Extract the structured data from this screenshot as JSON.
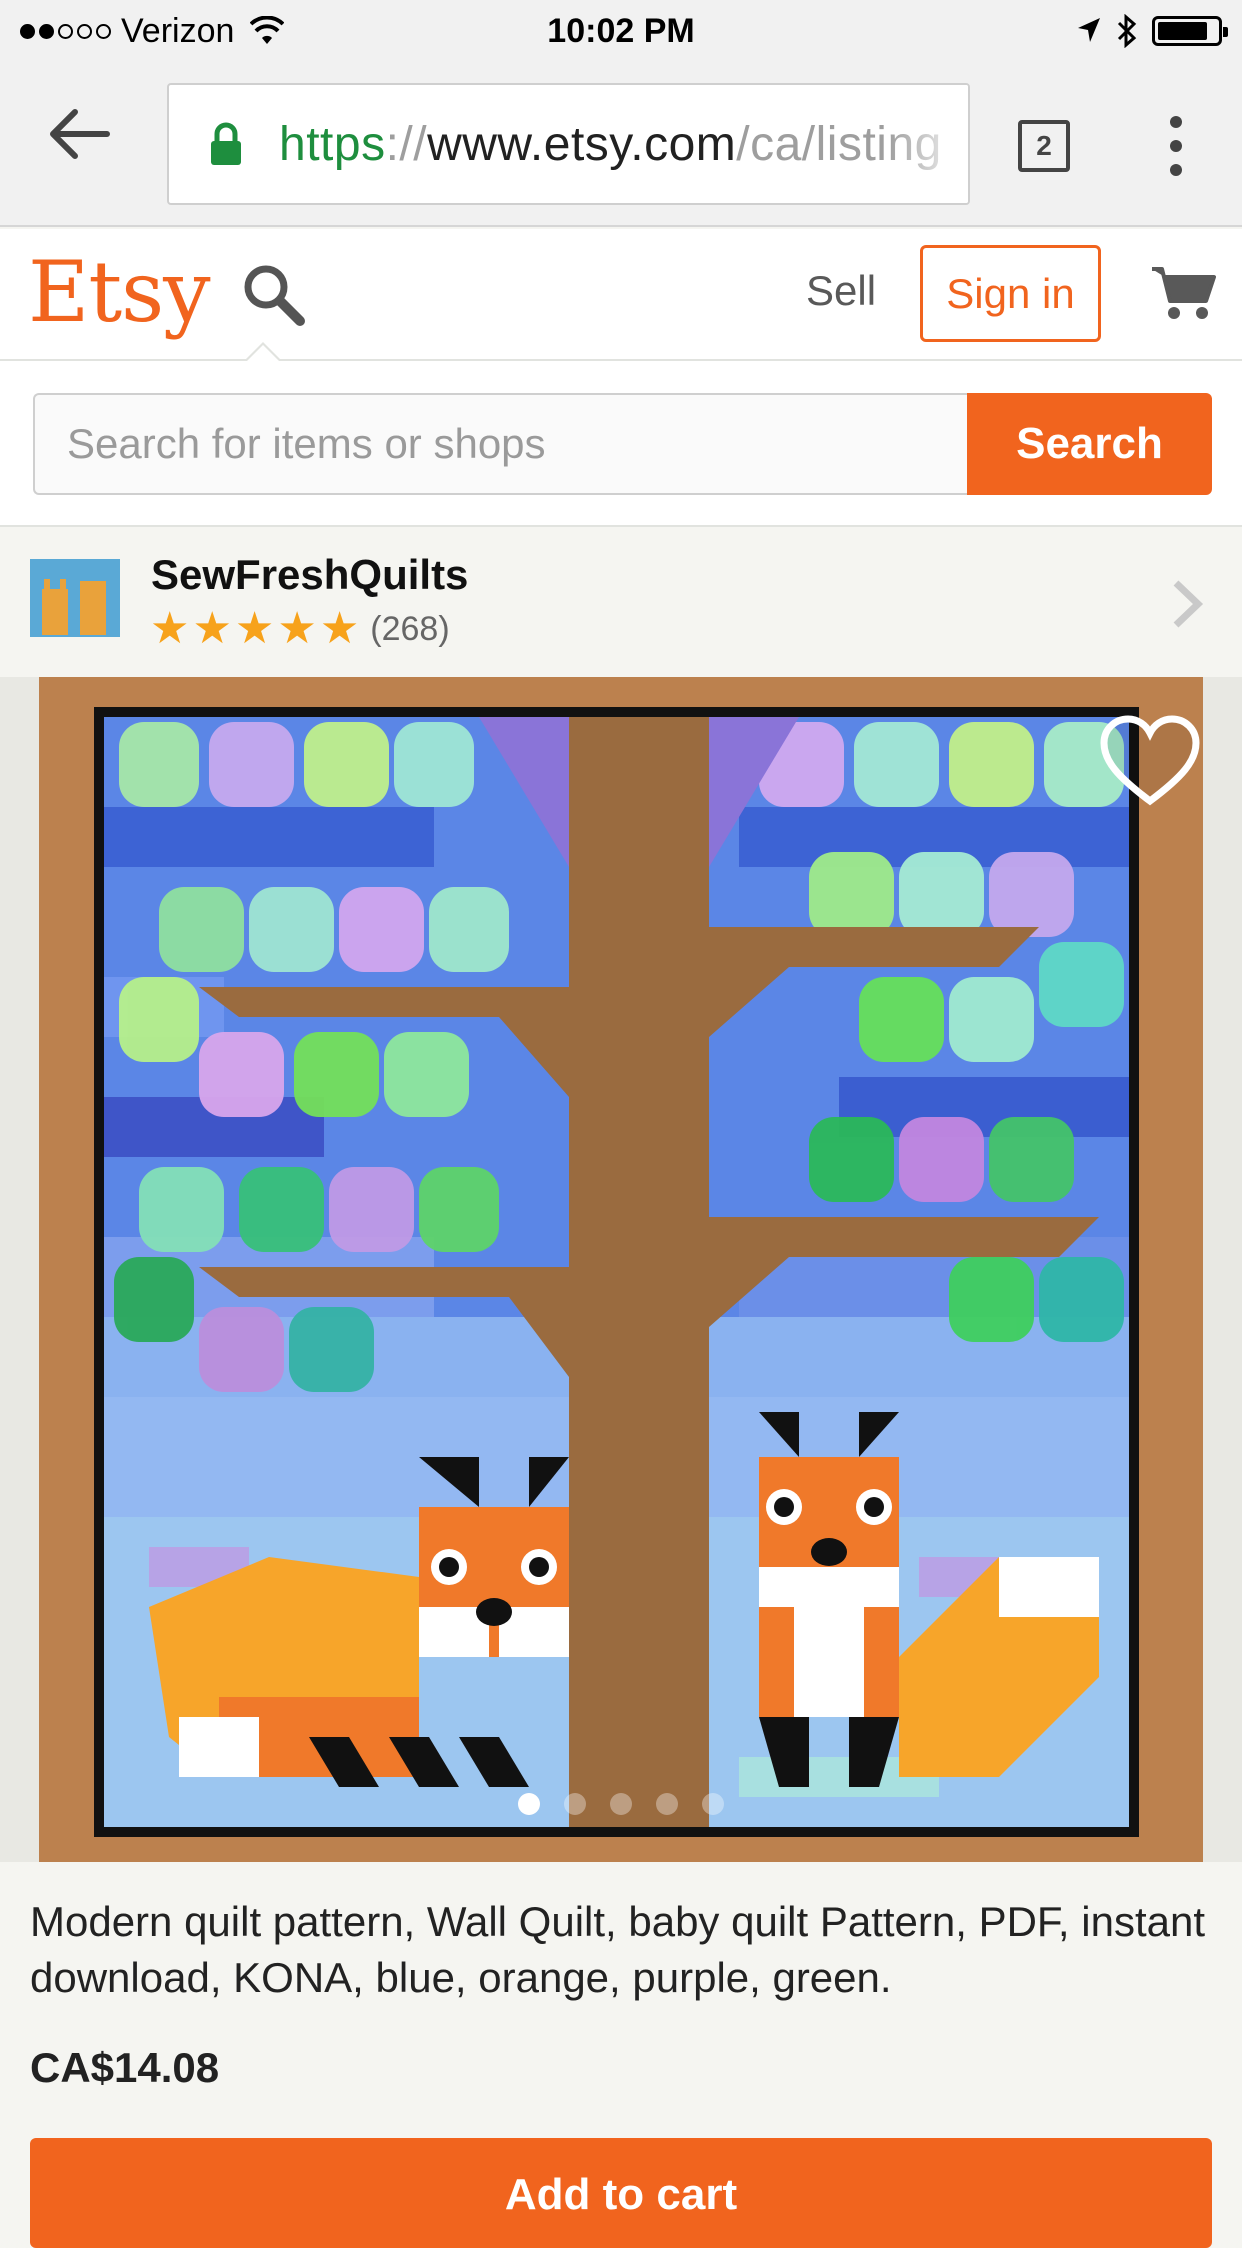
{
  "status_bar": {
    "carrier": "Verizon",
    "time": "10:02 PM",
    "signal_bars": 2,
    "signal_total": 5,
    "battery_level": 0.84
  },
  "browser": {
    "url_scheme": "https",
    "url_sep": "://",
    "url_host": "www.etsy.com",
    "url_path": "/ca/listing",
    "tab_count": "2"
  },
  "header": {
    "logo": "Etsy",
    "sell": "Sell",
    "sign_in": "Sign in"
  },
  "search": {
    "placeholder": "Search for items or shops",
    "button": "Search"
  },
  "shop": {
    "name": "SewFreshQuilts",
    "stars": 5,
    "review_count": "(268)"
  },
  "listing": {
    "carousel_total": 5,
    "carousel_active": 1,
    "title": "Modern quilt pattern, Wall Quilt, baby quilt Pattern, PDF, instant download, KONA, blue, orange, purple, green.",
    "price": "CA$14.08",
    "add_to_cart": "Add to cart"
  },
  "colors": {
    "brand": "#f1641e",
    "star": "#f7a21b",
    "secure": "#1e8e3e"
  },
  "icons": [
    "wifi-icon",
    "location-arrow-icon",
    "bluetooth-icon",
    "battery-icon",
    "back-arrow-icon",
    "lock-icon",
    "tabs-icon",
    "overflow-menu-icon",
    "search-icon",
    "cart-icon",
    "star-icon",
    "chevron-right-icon",
    "heart-icon"
  ]
}
